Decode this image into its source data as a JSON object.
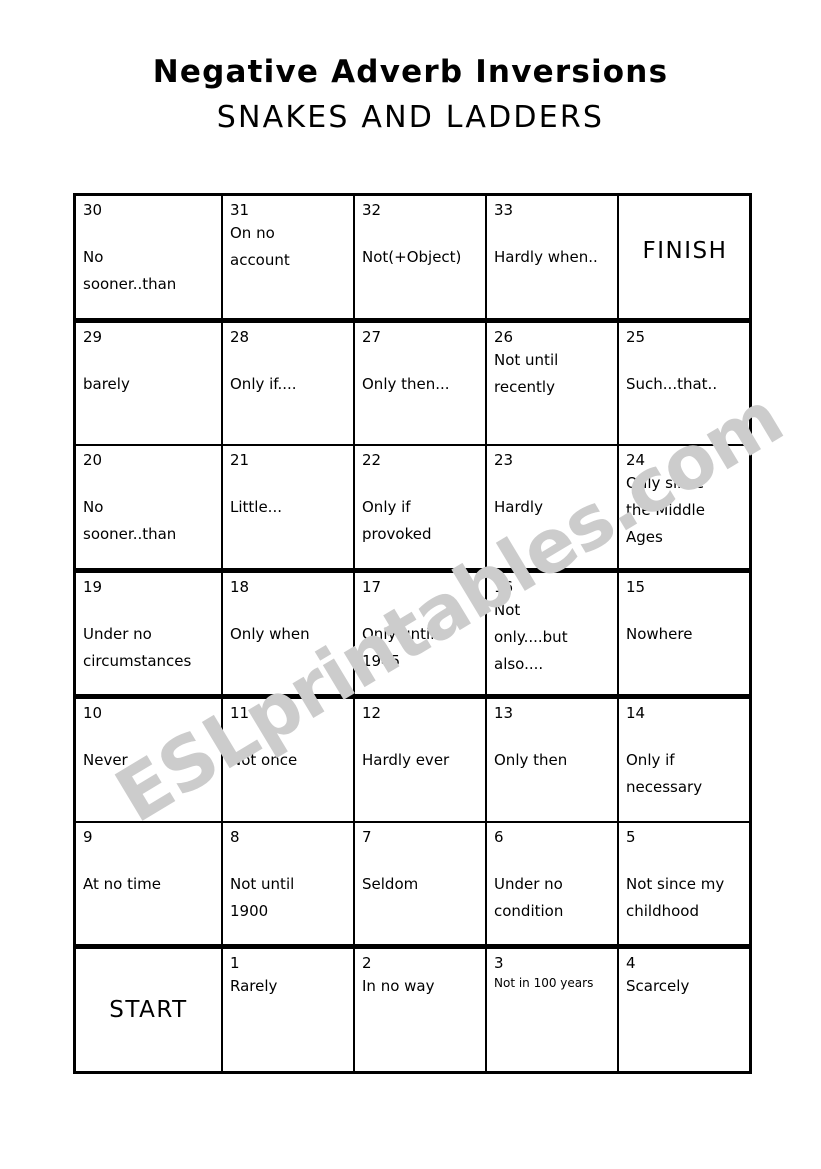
{
  "title": {
    "line1": "Negative Adverb Inversions",
    "line2": "SNAKES AND LADDERS"
  },
  "watermark": {
    "text": "ESLprintables.com",
    "color": "#cccccc"
  },
  "colors": {
    "ink": "#000000",
    "paper": "#ffffff",
    "watermark": "#cccccc"
  },
  "board": {
    "rows": 7,
    "columns": 5,
    "cells": [
      [
        {
          "number": "30",
          "text": "No\nsooner..than",
          "lead": 1
        },
        {
          "number": "31",
          "text": "On no\naccount",
          "lead": 0
        },
        {
          "number": "32",
          "text": "Not(+Object)",
          "lead": 1
        },
        {
          "number": "33",
          "text": "Hardly when..",
          "lead": 1
        },
        {
          "marker": "FINISH"
        }
      ],
      [
        {
          "number": "29",
          "text": "barely",
          "lead": 1
        },
        {
          "number": "28",
          "text": "Only if....",
          "lead": 1
        },
        {
          "number": "27",
          "text": "Only then...",
          "lead": 1
        },
        {
          "number": "26",
          "text": "Not until\nrecently",
          "lead": 0
        },
        {
          "number": "25",
          "text": "Such...that..",
          "lead": 1
        }
      ],
      [
        {
          "number": "20",
          "text": "No\nsooner..than",
          "lead": 1
        },
        {
          "number": "21",
          "text": "Little...",
          "lead": 1
        },
        {
          "number": "22",
          "text": "Only if\nprovoked",
          "lead": 1
        },
        {
          "number": "23",
          "text": "Hardly",
          "lead": 1
        },
        {
          "number": "24",
          "text": "Only since\nthe Middle\nAges",
          "lead": 0
        }
      ],
      [
        {
          "number": "19",
          "text": "Under no\ncircumstances",
          "lead": 1
        },
        {
          "number": "18",
          "text": "Only when",
          "lead": 1
        },
        {
          "number": "17",
          "text": "Only until\n1945",
          "lead": 1
        },
        {
          "number": "16",
          "text": "Not\nonly....but\nalso....",
          "lead": 0
        },
        {
          "number": "15",
          "text": "Nowhere",
          "lead": 1
        }
      ],
      [
        {
          "number": "10",
          "text": "Never",
          "lead": 1
        },
        {
          "number": "11",
          "text": "Not once",
          "lead": 1
        },
        {
          "number": "12",
          "text": "Hardly ever",
          "lead": 1
        },
        {
          "number": "13",
          "text": "Only then",
          "lead": 1
        },
        {
          "number": "14",
          "text": "Only if\nnecessary",
          "lead": 1
        }
      ],
      [
        {
          "number": "9",
          "text": "At no time",
          "lead": 1
        },
        {
          "number": "8",
          "text": "Not until\n1900",
          "lead": 1
        },
        {
          "number": "7",
          "text": "Seldom",
          "lead": 1
        },
        {
          "number": "6",
          "text": "Under no\ncondition",
          "lead": 1
        },
        {
          "number": "5",
          "text": "Not since my\nchildhood",
          "lead": 1
        }
      ],
      [
        {
          "marker": "START"
        },
        {
          "number": "1",
          "text": "Rarely",
          "lead": 0
        },
        {
          "number": "2",
          "text": "In no way",
          "lead": 0
        },
        {
          "number": "3",
          "text": "Not in 100 years",
          "lead": 0,
          "small": true
        },
        {
          "number": "4",
          "text": "Scarcely",
          "lead": 0
        }
      ]
    ]
  }
}
